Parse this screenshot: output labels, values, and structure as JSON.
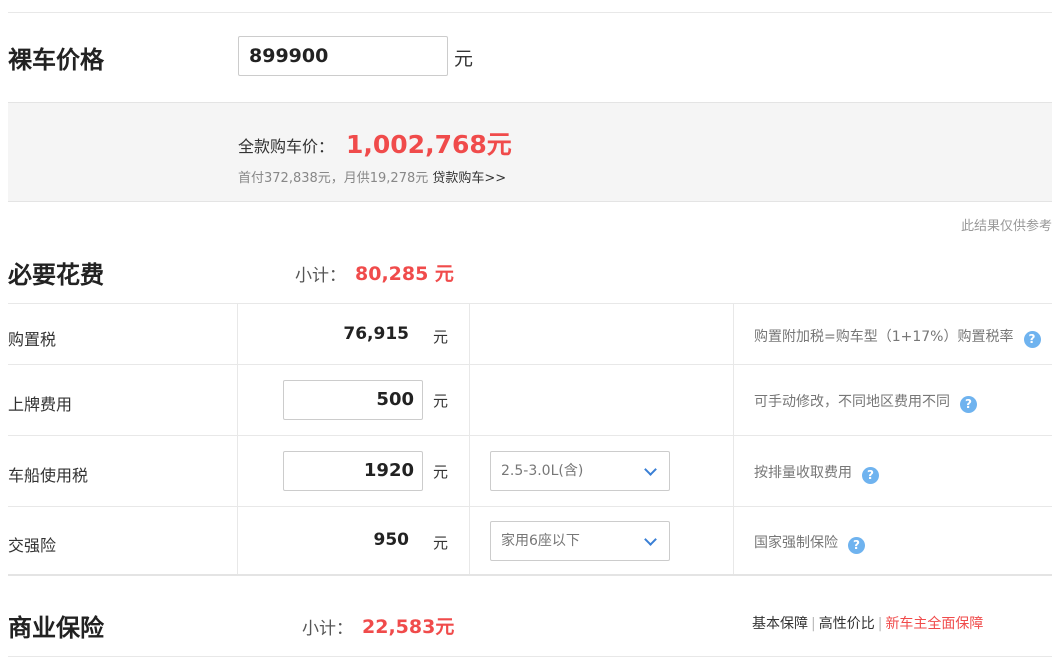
{
  "price": {
    "title": "裸车价格",
    "value": "899900",
    "unit": "元"
  },
  "summary": {
    "total_label": "全款购车价：",
    "total_value": "1,002,768元",
    "installment": "首付372,838元，月供19,278元",
    "loan_link": "贷款购车>>"
  },
  "disclaimer": "此结果仅供参考",
  "required": {
    "title": "必要花费",
    "subtotal_label": "小计：",
    "subtotal_value": "80,285 元",
    "rows": [
      {
        "name": "购置税",
        "amount": "76,915",
        "unit": "元",
        "note": "购置附加税=购车型（1+17%）购置税率"
      },
      {
        "name": "上牌费用",
        "amount": "500",
        "unit": "元",
        "note": "可手动修改，不同地区费用不同"
      },
      {
        "name": "车船使用税",
        "amount": "1920",
        "unit": "元",
        "select": "2.5-3.0L(含)",
        "note": "按排量收取费用"
      },
      {
        "name": "交强险",
        "amount": "950",
        "unit": "元",
        "select": "家用6座以下",
        "note": "国家强制保险"
      }
    ]
  },
  "commercial": {
    "title": "商业保险",
    "subtotal_label": "小计：",
    "subtotal_value": "22,583元",
    "plans": [
      "基本保障",
      "高性价比",
      "新车主全面保障"
    ]
  },
  "icons": {
    "help": "question-icon",
    "chevron": "chevron-down-icon"
  },
  "colors": {
    "accent": "#f04b4b",
    "help_icon": "#6fb3ef",
    "chevron": "#3a7fd5"
  }
}
